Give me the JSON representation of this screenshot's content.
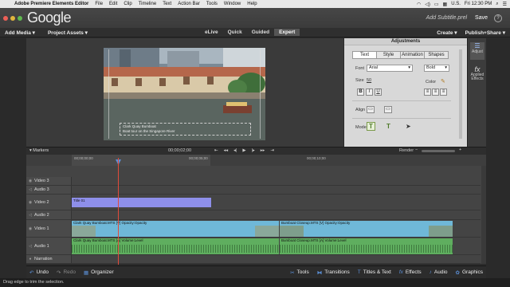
{
  "mac_menubar": {
    "app_name": "Adobe Premiere Elements Editor",
    "menus": [
      "File",
      "Edit",
      "Clip",
      "Timeline",
      "Text",
      "Action Bar",
      "Tools",
      "Window",
      "Help"
    ],
    "language": "U.S.",
    "clock": "Fri 12:30 PM"
  },
  "titlebar": {
    "logo_text": "Google",
    "project_name": "Add Subtitle.prel",
    "save_label": "Save",
    "help_label": "?"
  },
  "app_menu": {
    "add_media": "Add Media",
    "project_assets": "Project Assets",
    "modes": [
      "eLive",
      "Quick",
      "Guided",
      "Expert"
    ],
    "active_mode": "Expert",
    "create": "Create",
    "publish_share": "Publish+Share"
  },
  "video": {
    "subtitle_line1": "Clark Quay Bumboat",
    "subtitle_line2": "Boat tour on the Singapore River"
  },
  "adjustments": {
    "header": "Adjustments",
    "tabs": [
      "Text",
      "Style",
      "Animation",
      "Shapes"
    ],
    "active_tab": "Text",
    "font_label": "Font",
    "font_value": "Arial",
    "style_value": "Bold",
    "size_label": "Size",
    "size_value": "50",
    "color_label": "Color",
    "align_label": "Align",
    "mode_label": "Mode"
  },
  "right_rail": {
    "adjust_label": "Adjust",
    "applied_effects_label": "Applied Effects"
  },
  "timeline": {
    "markers_label": "Markers",
    "timecode": "00;00;02;00",
    "render_label": "Render",
    "ruler_ticks": [
      "00;00;00;00",
      "00;00;05;00",
      "00;00;10;00"
    ],
    "tracks": [
      {
        "name": "Video 3"
      },
      {
        "name": "Audio 3"
      },
      {
        "name": "Video 2"
      },
      {
        "name": "Audio 2"
      },
      {
        "name": "Video 1"
      },
      {
        "name": "Audio 1"
      },
      {
        "name": "Narration"
      }
    ],
    "clips": {
      "title_clip": "Title 01",
      "v1_clip_a": "Clark Quay Bumboat.MTS [V] Opacity:Opacity",
      "v1_clip_b": "Bumboat Closeup.MTS [V] Opacity:Opacity",
      "a1_clip_a": "Clark Quay Bumboat.MTS [A] Volume:Level",
      "a1_clip_b": "Bumboat Closeup.MTS [A] Volume:Level"
    }
  },
  "bottom_bar": {
    "undo": "Undo",
    "redo": "Redo",
    "organizer": "Organizer",
    "tools": "Tools",
    "transitions": "Transitions",
    "titles_text": "Titles & Text",
    "effects": "Effects",
    "audio": "Audio",
    "graphics": "Graphics"
  },
  "status": {
    "message": "Drag edge to trim the selection."
  },
  "colors": {
    "accent_blue": "#5b8fd6",
    "title_clip": "#8e8fea",
    "video_clip": "#6fb8d8",
    "audio_clip": "#5fae5f",
    "playhead": "#e14a3b"
  }
}
